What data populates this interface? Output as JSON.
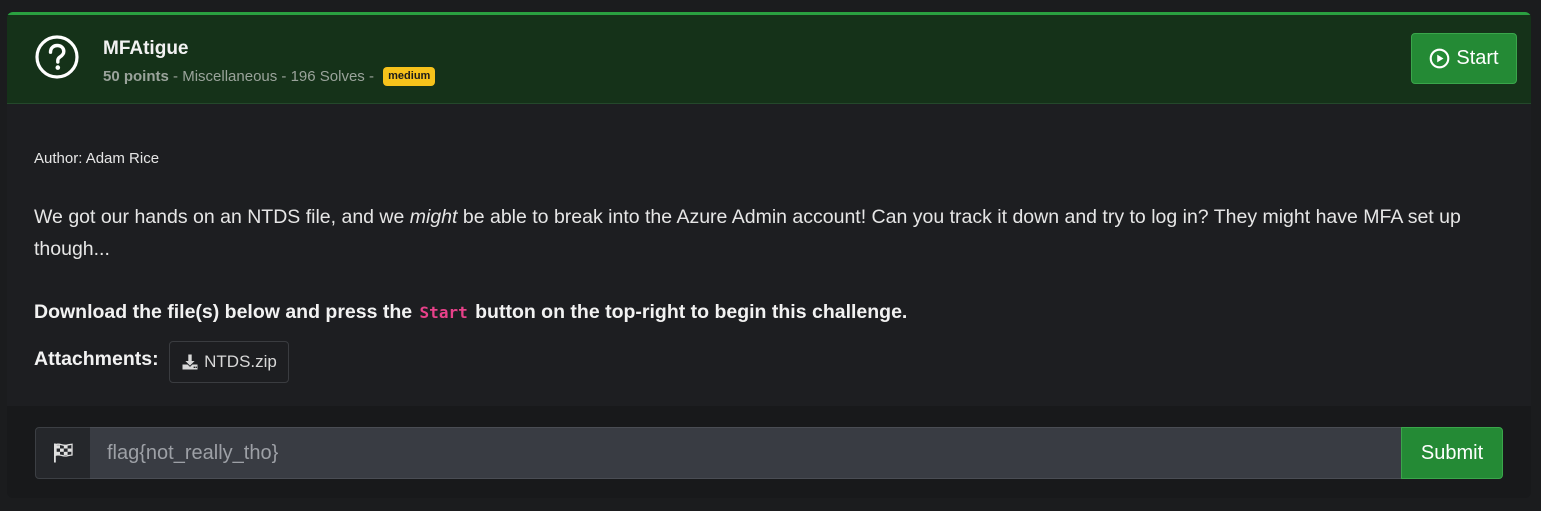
{
  "challenge": {
    "title": "MFAtigue",
    "points": "50 points",
    "meta_separator_1": " - ",
    "category": "Miscellaneous",
    "meta_separator_2": " - ",
    "solves": "196 Solves",
    "meta_separator_3": " - ",
    "difficulty": "medium",
    "start_label": "Start",
    "icon": "question-circle-icon"
  },
  "body": {
    "author": "Author: Adam Rice",
    "description_part1": "We got our hands on an NTDS file, and we ",
    "description_emphasis": "might",
    "description_part2": " be able to break into the Azure Admin account! Can you track it down and try to log in? They might have MFA set up though...",
    "instructions_part1": "Download the file(s) below and press the ",
    "instructions_code": "Start",
    "instructions_part2": " button on the top-right to begin this challenge.",
    "attachments_label": "Attachments:",
    "attachments": [
      {
        "name": "NTDS.zip",
        "icon": "download-icon"
      }
    ]
  },
  "submission": {
    "flag_icon": "checkered-flag-icon",
    "placeholder": "flag{not_really_tho}",
    "submit_label": "Submit"
  },
  "colors": {
    "header_bg": "#153219",
    "accent_green": "#248a35",
    "badge_yellow": "#f6c21b",
    "code_pink": "#e8418a"
  }
}
